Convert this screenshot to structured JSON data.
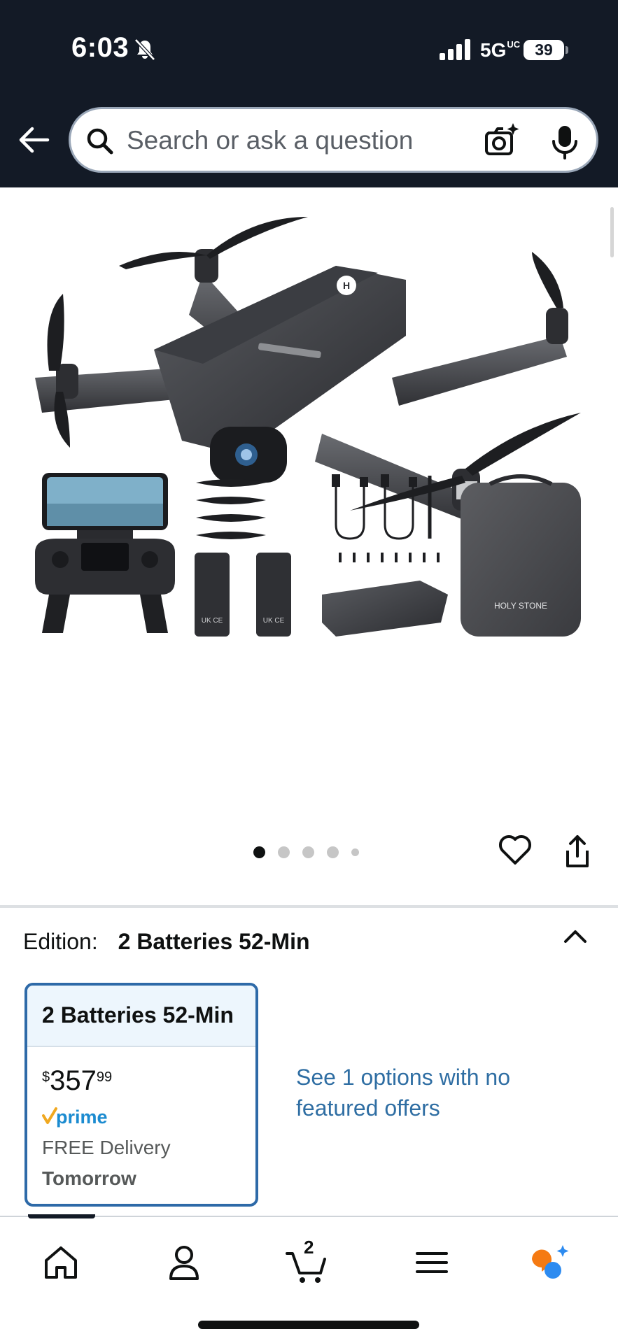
{
  "status_bar": {
    "time": "6:03",
    "network": "5G",
    "network_sub": "UC",
    "battery": "39"
  },
  "search": {
    "placeholder": "Search or ask a question"
  },
  "product": {
    "image_alt": "Holy Stone drone with remote controller, propellers, 2 batteries, cables, screwdriver, screws and carrying case",
    "brand_mark": "HOLY STONE"
  },
  "carousel": {
    "total_slides": 5,
    "active_slide": 1
  },
  "edition": {
    "label": "Edition:",
    "value": "2 Batteries 52-Min"
  },
  "option_card": {
    "title": "2 Batteries 52-Min",
    "price_symbol": "$",
    "price_whole": "357",
    "price_fraction": "99",
    "prime_label": "prime",
    "delivery": "FREE Delivery",
    "delivery_day": "Tomorrow"
  },
  "see_options": "See 1 options with no featured offers",
  "bottom_nav": {
    "cart_count": "2",
    "items": [
      "home-icon",
      "account-icon",
      "cart-icon",
      "menu-icon",
      "rufus-icon"
    ]
  },
  "colors": {
    "header_bg": "#131a26",
    "card_border": "#2e6aa8",
    "link": "#2f6ea3",
    "prime_blue": "#1b8bd0",
    "prime_check": "#f0a820",
    "rufus_orange": "#f57a12",
    "rufus_blue": "#2d8bf0"
  }
}
